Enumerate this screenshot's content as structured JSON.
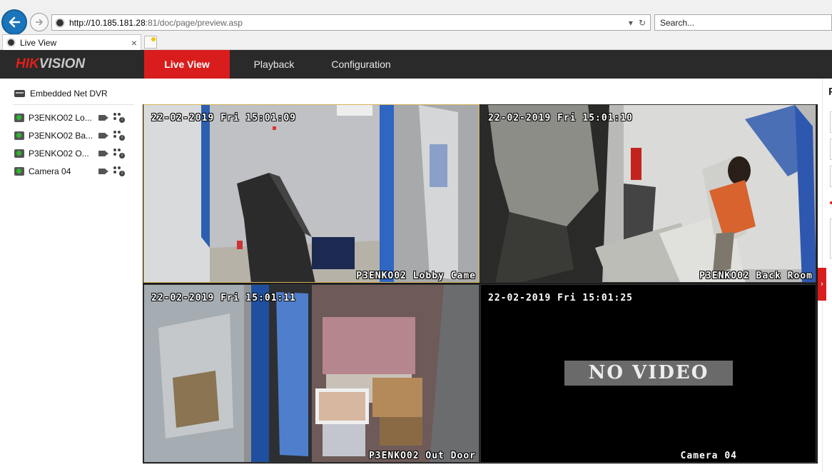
{
  "browser": {
    "url_host": "http://10.185.181.28",
    "url_rest": ":81/doc/page/preview.asp",
    "search_placeholder": "Search...",
    "tab_title": "Live View",
    "tab_close": "×"
  },
  "app": {
    "logo_red": "HIK",
    "logo_grey": "VISION",
    "nav": {
      "live_view": "Live View",
      "playback": "Playback",
      "configuration": "Configuration"
    }
  },
  "device_tree": {
    "device_name": "Embedded Net DVR",
    "cameras": [
      {
        "label": "P3ENKO02 Lo..."
      },
      {
        "label": "P3ENKO02 Ba..."
      },
      {
        "label": "P3ENKO02 O..."
      },
      {
        "label": "Camera 04"
      }
    ]
  },
  "video_grid": {
    "channels": [
      {
        "timestamp": "22-02-2019 Fri 15:01:09",
        "osd_name": "P3ENKO02 Lobby Came",
        "selected": true
      },
      {
        "timestamp": "22-02-2019 Fri 15:01:10",
        "osd_name": "P3ENKO02 Back Room",
        "selected": false
      },
      {
        "timestamp": "22-02-2019 Fri 15:01:11",
        "osd_name": "P3ENKO02 Out Door",
        "selected": false
      },
      {
        "timestamp": "22-02-2019 Fri 15:01:25",
        "osd_name": "Camera 04",
        "selected": false,
        "no_video_text": "NO VIDEO"
      }
    ]
  },
  "right_panel": {
    "header_letter": "P",
    "collapse_glyph": "›"
  },
  "colors": {
    "accent_red": "#d91d1d",
    "header_bg": "#2a2a2a",
    "browser_back_blue": "#1a75bb"
  }
}
